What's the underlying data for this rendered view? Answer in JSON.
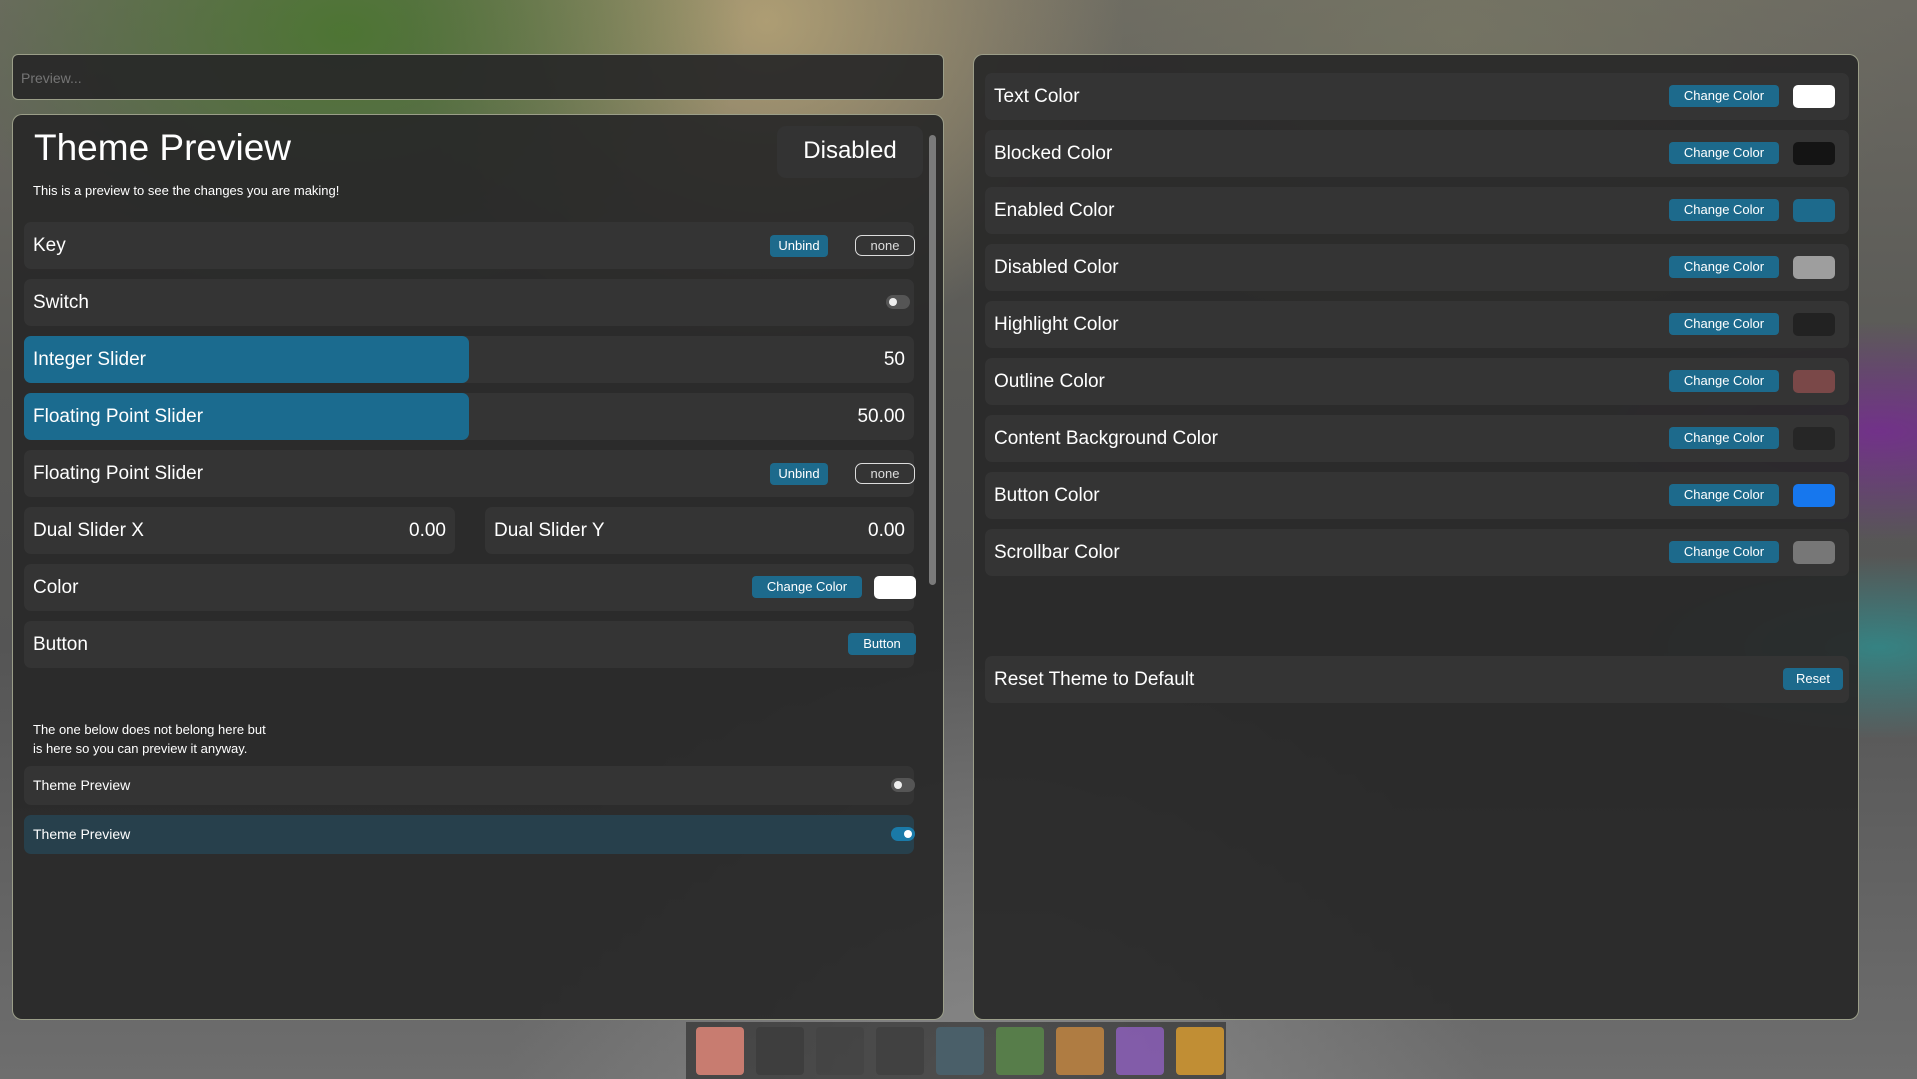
{
  "search": {
    "placeholder": "Preview..."
  },
  "preview": {
    "title": "Theme Preview",
    "subtitle": "This is a preview to see the changes you are making!",
    "status": "Disabled",
    "rows": {
      "key": {
        "label": "Key",
        "unbind": "Unbind",
        "value": "none"
      },
      "switch": {
        "label": "Switch",
        "on": false
      },
      "integer_slider": {
        "label": "Integer Slider",
        "value": "50",
        "fraction": 0.5
      },
      "float_slider": {
        "label": "Floating Point Slider",
        "value": "50.00",
        "fraction": 0.5
      },
      "float_slider_bind": {
        "label": "Floating Point Slider",
        "unbind": "Unbind",
        "value": "none"
      },
      "dual_x": {
        "label": "Dual Slider X",
        "value": "0.00"
      },
      "dual_y": {
        "label": "Dual Slider Y",
        "value": "0.00"
      },
      "color": {
        "label": "Color",
        "button": "Change Color",
        "swatch": "#ffffff"
      },
      "button": {
        "label": "Button",
        "button": "Button"
      }
    },
    "note_line1": "The one below does not belong here but",
    "note_line2": "is here so you can preview it anyway.",
    "theme_toggle_off": {
      "label": "Theme Preview",
      "on": false
    },
    "theme_toggle_on": {
      "label": "Theme Preview",
      "on": true
    }
  },
  "colors": {
    "change_label": "Change Color",
    "items": [
      {
        "label": "Text Color",
        "swatch": "#ffffff"
      },
      {
        "label": "Blocked Color",
        "swatch": "#141414"
      },
      {
        "label": "Enabled Color",
        "swatch": "#1d6a8c"
      },
      {
        "label": "Disabled Color",
        "swatch": "#9e9e9e"
      },
      {
        "label": "Highlight Color",
        "swatch": "#222222"
      },
      {
        "label": "Outline Color",
        "swatch": "#7a4848"
      },
      {
        "label": "Content Background Color",
        "swatch": "#262626"
      },
      {
        "label": "Button Color",
        "swatch": "#1677ee"
      },
      {
        "label": "Scrollbar Color",
        "swatch": "#777777"
      }
    ],
    "reset": {
      "label": "Reset Theme to Default",
      "button": "Reset"
    }
  }
}
